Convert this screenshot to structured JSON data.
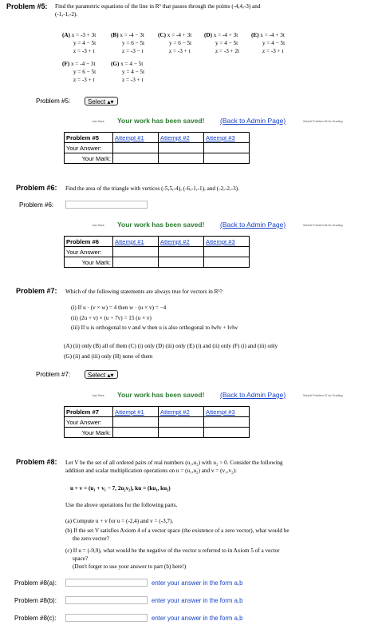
{
  "p5": {
    "title": "Problem #5:",
    "text1": "Find the parametric equations of the line in R³ that passes through the points (-4,4,-3) and",
    "text2": "(-1,-1,-2).",
    "options_row1": [
      {
        "label": "(A)",
        "l1": "x = -3 + 3t",
        "l2": "y = 4 − 5t",
        "l3": "z = -3 + t"
      },
      {
        "label": "(B)",
        "l1": "x = -4 − 3t",
        "l2": "y = 6 − 5t",
        "l3": "z = -3 − t"
      },
      {
        "label": "(C)",
        "l1": "x = -4 + 3t",
        "l2": "y = 6 − 5t",
        "l3": "z = -3 + t"
      },
      {
        "label": "(D)",
        "l1": "x = -4 + 3t",
        "l2": "y = 4 − 5t",
        "l3": "z = -3 + 2t"
      },
      {
        "label": "(E)",
        "l1": "x = -4 + 3t",
        "l2": "y = 4 − 5t",
        "l3": "z = -3 + t"
      }
    ],
    "options_row2": [
      {
        "label": "(F)",
        "l1": "x = -4 − 3t",
        "l2": "y = 6 − 5t",
        "l3": "z = -3 + t"
      },
      {
        "label": "(G)",
        "l1": "x = 4 − 5t",
        "l2": "y = 4 − 5t",
        "l3": "z = -3 + t"
      }
    ],
    "select_label": "Problem #5:",
    "select_value": "Select",
    "just_save": "Just Save",
    "saved_msg": "Your work has been saved!",
    "back_link": "(Back to Admin Page)",
    "submit": "Submit Problem #5 for Grading",
    "table": {
      "header": "Problem #5",
      "attempts": [
        "Attempt #1",
        "Attempt #2",
        "Attempt #3"
      ],
      "your_answer": "Your Answer:",
      "your_mark": "Your Mark:"
    }
  },
  "p6": {
    "title": "Problem #6:",
    "text": "Find the area of the triangle with vertices (-5,5,-4), (-6,-1,-1), and (-2,-2,-3).",
    "input_label": "Problem #6:",
    "just_save": "Just Save",
    "saved_msg": "Your work has been saved!",
    "back_link": "(Back to Admin Page)",
    "submit": "Submit Problem #6 for Grading",
    "table": {
      "header": "Problem #6",
      "attempts": [
        "Attempt #1",
        "Attempt #2",
        "Attempt #3"
      ],
      "your_answer": "Your Answer:",
      "your_mark": "Your Mark:"
    }
  },
  "p7": {
    "title": "Problem #7:",
    "text": "Which of the following statements are always true for vectors in R³?",
    "items": [
      "(i) If u · (v × w) = 4 then w · (u × v) = −4",
      "(ii) (2u + v) × (u + 7v) = 15 (u × v)",
      "(iii) If u is orthogonal to v and w then u is also orthogonal to ‖w‖v + ‖v‖w"
    ],
    "choices1": "(A) (ii) only  (B) all of them  (C) (i) only  (D) (iii) only  (E) (i) and (ii) only  (F) (i) and (iii) only",
    "choices2": "(G) (ii) and (iii) only  (H) none of them",
    "select_label": "Problem #7:",
    "select_value": "Select",
    "just_save": "Just Save",
    "saved_msg": "Your work has been saved!",
    "back_link": "(Back to Admin Page)",
    "submit": "Submit Problem #7 for Grading",
    "table": {
      "header": "Problem #7",
      "attempts": [
        "Attempt #1",
        "Attempt #2",
        "Attempt #3"
      ],
      "your_answer": "Your Answer:",
      "your_mark": "Your Mark:"
    }
  },
  "p8": {
    "title": "Problem #8:",
    "text1": "Let V be the set of all ordered pairs of real numbers (u₁,u₂) with u₂ > 0. Consider the following",
    "text2": "addition and scalar multiplication operations on u = (u₁,u₂) and v = (v₁,v₂):",
    "formula": "u + v = (u₁ + v₁ − 7, 2u₂v₂),    ku = (ku₁, ku₂)",
    "use_text": "Use the above operations for the following parts.",
    "a": "(a) Compute u + v for u = (-2,4) and v = (-3,7).",
    "b1": "(b) If the set V satisfies Axiom 4 of a vector space (the existence of a zero vector), what would be",
    "b2": "the zero vector?",
    "c1": "(c) If u = (-9,9), what would be the negative of the vector u referred to in Axiom 5 of a vector",
    "c2": "space?",
    "c3": "(Don't forget to use your answer to part (b) here!)",
    "inputs": [
      {
        "label": "Problem #8(a):",
        "hint": "enter your answer in the form a,b"
      },
      {
        "label": "Problem #8(b):",
        "hint": "enter your answer in the form a,b"
      },
      {
        "label": "Problem #8(c):",
        "hint": "enter your answer in the form a,b"
      }
    ]
  }
}
